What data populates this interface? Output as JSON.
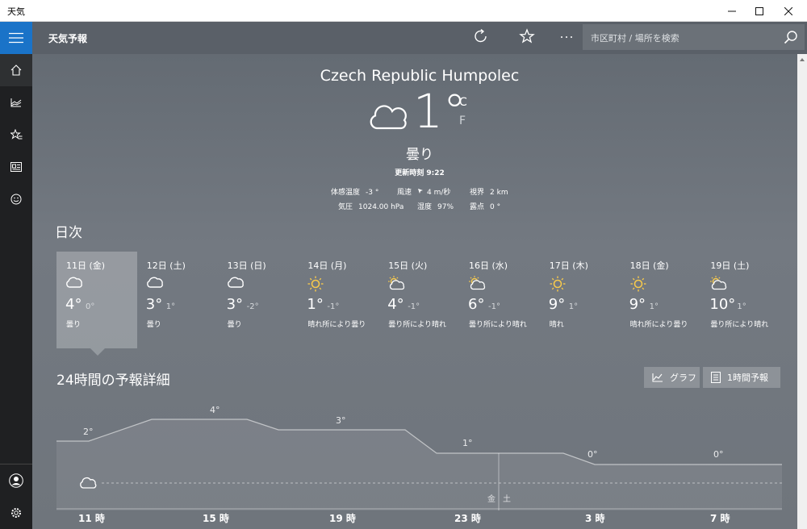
{
  "window": {
    "title": "天気"
  },
  "app": {
    "title": "天気予報",
    "search_placeholder": "市区町村 / 場所を検索"
  },
  "current": {
    "location": "Czech Republic Humpolec",
    "temp": "1°",
    "unit_c": "C",
    "unit_f": "F",
    "condition": "曇り",
    "updated": "更新時刻 9:22",
    "details": {
      "feels_like_label": "体感温度",
      "feels_like": "-3 °",
      "wind_label": "風速",
      "wind": "4 m/秒",
      "visibility_label": "視界",
      "visibility": "2 km",
      "pressure_label": "気圧",
      "pressure": "1024.00 hPa",
      "humidity_label": "湿度",
      "humidity": "97%",
      "dewpoint_label": "露点",
      "dewpoint": "0 °"
    }
  },
  "daily": {
    "title": "日次",
    "days": [
      {
        "date": "11日 (金)",
        "hi": "4°",
        "lo": "0°",
        "cond": "曇り",
        "icon": "cloud-icon"
      },
      {
        "date": "12日 (土)",
        "hi": "3°",
        "lo": "1°",
        "cond": "曇り",
        "icon": "cloud-icon"
      },
      {
        "date": "13日 (日)",
        "hi": "3°",
        "lo": "-2°",
        "cond": "曇り",
        "icon": "cloud-icon"
      },
      {
        "date": "14日 (月)",
        "hi": "1°",
        "lo": "-1°",
        "cond": "晴れ所により曇り",
        "icon": "sun-icon"
      },
      {
        "date": "15日 (火)",
        "hi": "4°",
        "lo": "-1°",
        "cond": "曇り所により晴れ",
        "icon": "partly-cloudy-icon"
      },
      {
        "date": "16日 (水)",
        "hi": "6°",
        "lo": "-1°",
        "cond": "曇り所により晴れ",
        "icon": "partly-cloudy-icon"
      },
      {
        "date": "17日 (木)",
        "hi": "9°",
        "lo": "1°",
        "cond": "晴れ",
        "icon": "sun-icon"
      },
      {
        "date": "18日 (金)",
        "hi": "9°",
        "lo": "1°",
        "cond": "晴れ所により曇り",
        "icon": "sun-icon"
      },
      {
        "date": "19日 (土)",
        "hi": "10°",
        "lo": "1°",
        "cond": "曇り所により晴れ",
        "icon": "partly-cloudy-icon"
      }
    ]
  },
  "hourly": {
    "title": "24時間の予報詳細",
    "graph_label": "グラフ",
    "hourly_label": "1時間予報",
    "temp_labels": [
      "2°",
      "4°",
      "3°",
      "1°",
      "0°",
      "0°"
    ],
    "day_change": [
      "金",
      "土"
    ],
    "times": [
      "11 時",
      "15 時",
      "19 時",
      "23 時",
      "3 時",
      "7 時"
    ]
  },
  "colors": {
    "accent": "#1a73c8",
    "sun": "#f5c84c"
  }
}
